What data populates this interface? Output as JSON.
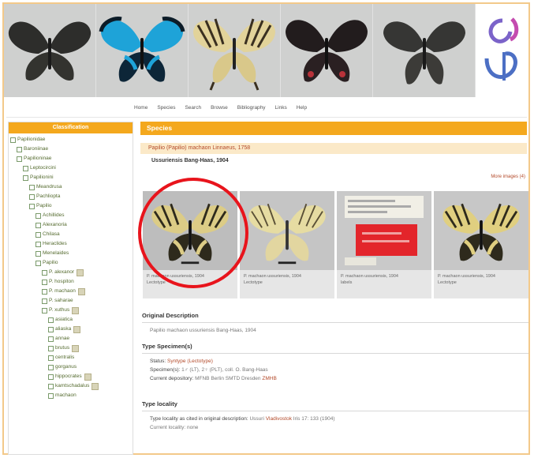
{
  "banner": {
    "panels": [
      {
        "icon": "black-swallowtail-butterfly-icon"
      },
      {
        "icon": "blue-swallowtail-butterfly-icon"
      },
      {
        "icon": "yellow-swallowtail-butterfly-icon"
      },
      {
        "icon": "black-red-swallowtail-butterfly-icon"
      },
      {
        "icon": "dark-swallowtail-butterfly-icon"
      }
    ],
    "logo_icon": "site-logo-icon"
  },
  "topnav": [
    "Home",
    "Species",
    "Search",
    "Browse",
    "Bibliography",
    "Links",
    "Help"
  ],
  "sidebar": {
    "title": "Classification",
    "items": [
      {
        "label": "Papilionidae",
        "indent": 0,
        "tag": false
      },
      {
        "label": "Baroniinae",
        "indent": 1,
        "tag": false
      },
      {
        "label": "Papilioninae",
        "indent": 1,
        "tag": false
      },
      {
        "label": "Leptocircini",
        "indent": 2,
        "tag": false
      },
      {
        "label": "Papilionini",
        "indent": 2,
        "tag": false
      },
      {
        "label": "Meandrusa",
        "indent": 3,
        "tag": false
      },
      {
        "label": "Pachliopta",
        "indent": 3,
        "tag": false
      },
      {
        "label": "Papilio",
        "indent": 3,
        "tag": false
      },
      {
        "label": "Achillides",
        "indent": 4,
        "tag": false
      },
      {
        "label": "Alexanoria",
        "indent": 4,
        "tag": false
      },
      {
        "label": "Chilasa",
        "indent": 4,
        "tag": false
      },
      {
        "label": "Heraclides",
        "indent": 4,
        "tag": false
      },
      {
        "label": "Menelaides",
        "indent": 4,
        "tag": false
      },
      {
        "label": "Papilio",
        "indent": 4,
        "tag": false
      },
      {
        "label": "P. alexanor",
        "indent": 5,
        "tag": true
      },
      {
        "label": "P. hospiton",
        "indent": 5,
        "tag": false
      },
      {
        "label": "P. machaon",
        "indent": 5,
        "tag": true
      },
      {
        "label": "P. saharae",
        "indent": 5,
        "tag": false
      },
      {
        "label": "P. xuthus",
        "indent": 5,
        "tag": true
      },
      {
        "label": "asiatica",
        "indent": 6,
        "tag": false
      },
      {
        "label": "aliaska",
        "indent": 6,
        "tag": true
      },
      {
        "label": "annae",
        "indent": 6,
        "tag": false
      },
      {
        "label": "brutus",
        "indent": 6,
        "tag": true
      },
      {
        "label": "centralis",
        "indent": 6,
        "tag": false
      },
      {
        "label": "gorganus",
        "indent": 6,
        "tag": false
      },
      {
        "label": "hippocrates",
        "indent": 6,
        "tag": true
      },
      {
        "label": "kamtschadalus",
        "indent": 6,
        "tag": true
      },
      {
        "label": "machaon",
        "indent": 6,
        "tag": false
      }
    ]
  },
  "main": {
    "section_title": "Species",
    "taxon_name": "Papilio (Papilio) machaon Linnaeus, 1758",
    "subspecies": "Ussuriensis Bang-Haas, 1904",
    "more_images_link": "More images (4)",
    "thumbnails": [
      {
        "icon": "yellow-swallowtail-specimen-icon",
        "caption_1": "P. machaon ussuriensis, 1904",
        "caption_2": "Lectotype"
      },
      {
        "icon": "yellow-swallowtail-specimen-underside-icon",
        "caption_1": "P. machaon ussuriensis, 1904",
        "caption_2": "Lectotype"
      },
      {
        "icon": "specimen-labels-icon",
        "caption_1": "P. machaon ussuriensis, 1904",
        "caption_2": "labels"
      },
      {
        "icon": "yellow-swallowtail-specimen-icon",
        "caption_1": "P. machaon ussuriensis, 1904",
        "caption_2": "Lectotype"
      }
    ],
    "original_description": {
      "title": "Original Description",
      "text": "Papilio machaon ussuriensis Bang-Haas, 1904"
    },
    "type_specimens": {
      "title": "Type Specimen(s)",
      "status_label": "Status:",
      "status_value": "Syntype (Lectotype)",
      "specimens_label": "Specimen(s):",
      "specimens_value": "1♂ (LT), 2♀ (PLT), coll. O. Bang-Haas",
      "depository_label": "Current depository:",
      "depository_value": "MFNB Berlin",
      "depository_extra": "SMTD Dresden",
      "depository_link": "ZMHB"
    },
    "type_locality": {
      "title": "Type locality",
      "line_label": "Type locality as cited in original description:",
      "line_value": "Ussuri",
      "line_link": "Vladivostok",
      "line_suffix": "Iris 17: 133 (1904)",
      "line_2": "",
      "line_3": "Current locality: none"
    }
  }
}
